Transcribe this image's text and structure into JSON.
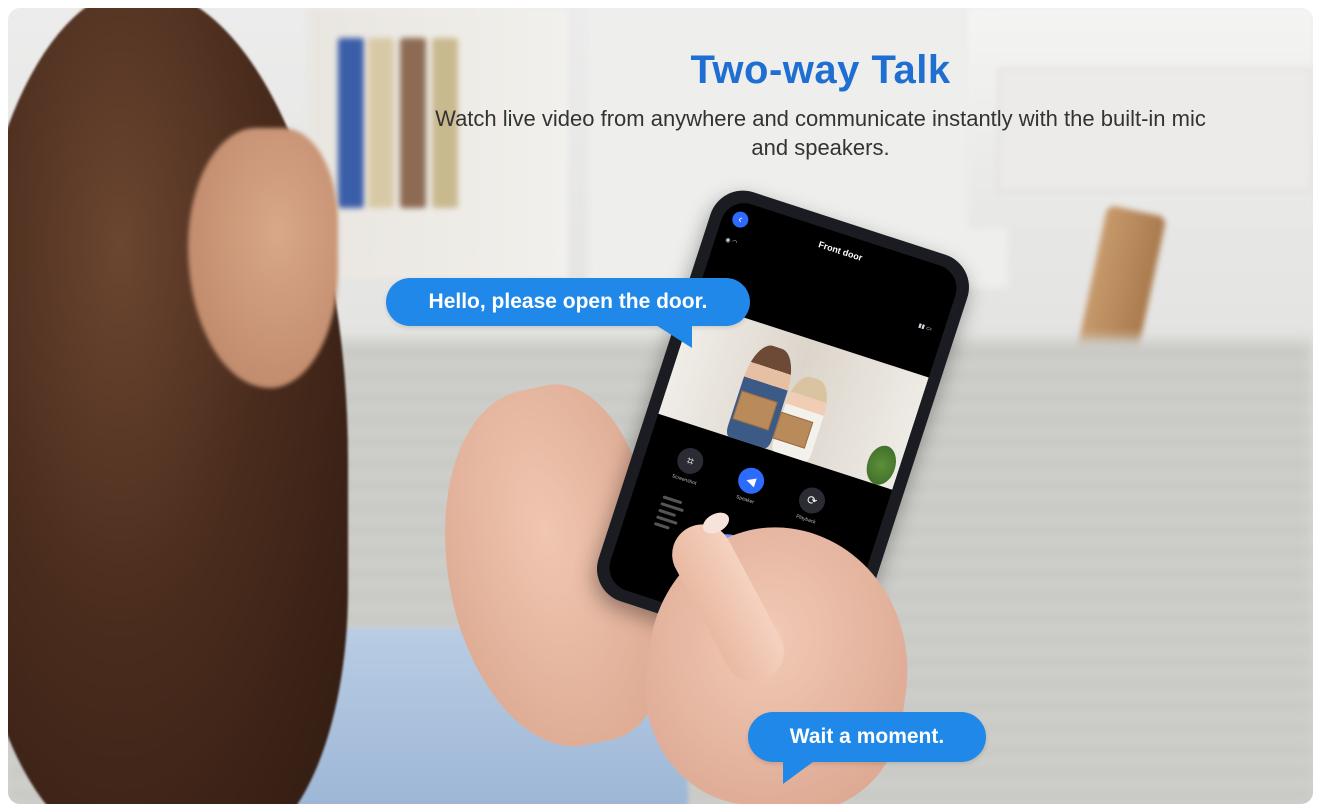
{
  "headline": "Two-way Talk",
  "subline": "Watch live video from anywhere and communicate instantly with the built-in mic and speakers.",
  "bubbles": {
    "visitor": "Hello, please open the door.",
    "reply": "Wait a moment."
  },
  "phone": {
    "title": "Front door",
    "controls": {
      "screenshot_label": "Screenshot",
      "speaker_label": "Speaker",
      "playback_label": "Playback"
    }
  },
  "colors": {
    "headline": "#1f6fd3",
    "bubble": "#1f88e8",
    "accent": "#2d6bff"
  },
  "icons": {
    "back": "chevron-left-icon",
    "crop": "crop-icon",
    "speaker": "speaker-icon",
    "playback": "playback-icon",
    "mic": "microphone-icon"
  }
}
